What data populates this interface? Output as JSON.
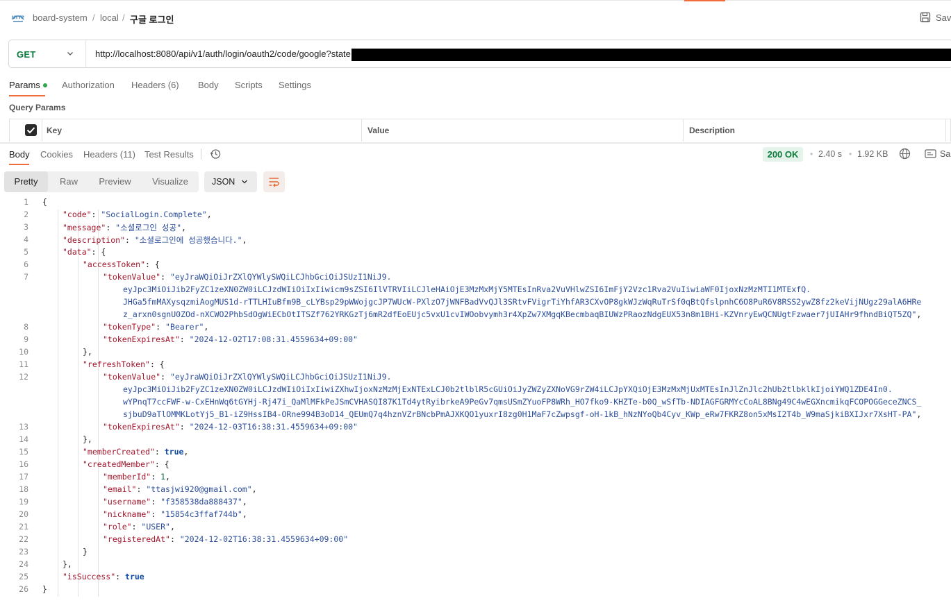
{
  "header": {
    "breadcrumb": [
      "board-system",
      "local",
      "구글 로그인"
    ],
    "save_label": "Save"
  },
  "request": {
    "method": "GET",
    "url": "http://localhost:8080/api/v1/auth/login/oauth2/code/google?state"
  },
  "request_tabs": [
    {
      "label": "Params"
    },
    {
      "label": "Authorization"
    },
    {
      "label": "Headers (6)"
    },
    {
      "label": "Body"
    },
    {
      "label": "Scripts"
    },
    {
      "label": "Settings"
    }
  ],
  "query_params": {
    "title": "Query Params",
    "columns": [
      "Key",
      "Value",
      "Description"
    ]
  },
  "response_tabs": [
    {
      "label": "Body"
    },
    {
      "label": "Cookies"
    },
    {
      "label": "Headers (11)"
    },
    {
      "label": "Test Results"
    }
  ],
  "response_meta": {
    "status": "200 OK",
    "time": "2.40 s",
    "size": "1.92 KB",
    "save_label": "Sa"
  },
  "view_modes": [
    "Pretty",
    "Raw",
    "Preview",
    "Visualize"
  ],
  "format": "JSON",
  "code_lines": [
    {
      "n": "1",
      "d": 0,
      "t": [
        [
          "p",
          "{"
        ]
      ]
    },
    {
      "n": "2",
      "d": 1,
      "t": [
        [
          "k",
          "\"code\""
        ],
        [
          "p",
          ": "
        ],
        [
          "s",
          "\"SocialLogin.Complete\""
        ],
        [
          "p",
          ","
        ]
      ]
    },
    {
      "n": "3",
      "d": 1,
      "t": [
        [
          "k",
          "\"message\""
        ],
        [
          "p",
          ": "
        ],
        [
          "s",
          "\"소셜로그인 성공\""
        ],
        [
          "p",
          ","
        ]
      ]
    },
    {
      "n": "4",
      "d": 1,
      "t": [
        [
          "k",
          "\"description\""
        ],
        [
          "p",
          ": "
        ],
        [
          "s",
          "\"소셜로그인에 성공했습니다.\""
        ],
        [
          "p",
          ","
        ]
      ]
    },
    {
      "n": "5",
      "d": 1,
      "t": [
        [
          "k",
          "\"data\""
        ],
        [
          "p",
          ": {"
        ]
      ]
    },
    {
      "n": "6",
      "d": 2,
      "t": [
        [
          "k",
          "\"accessToken\""
        ],
        [
          "p",
          ": {"
        ]
      ]
    },
    {
      "n": "7",
      "d": 3,
      "t": [
        [
          "k",
          "\"tokenValue\""
        ],
        [
          "p",
          ": "
        ],
        [
          "s",
          "\"eyJraWQiOiJrZXlQYWlySWQiLCJhbGciOiJSUzI1NiJ9."
        ]
      ]
    },
    {
      "n": "",
      "d": 4,
      "t": [
        [
          "s",
          "eyJpc3MiOiJib2FyZC1zeXN0ZW0iLCJzdWIiOiIxIiwicm9sZSI6IlVTRVIiLCJleHAiOjE3MzMxMjY5MTEsInRva2VuVHlwZSI6ImFjY2Vzc1Rva2VuIiwiaWF0IjoxNzMzMTI1MTExfQ."
        ]
      ]
    },
    {
      "n": "",
      "d": 4,
      "t": [
        [
          "s",
          "JHGa5fmMAXysqzmiAogMUS1d-rTTLHIuBfm9B_cLYBsp29pWWojgcJP7WUcW-PXlzO7jWNFBadVvQJl3SRtvFVigrTiYhfAR3CXvOP8gkWJzWqRuTrSf0qBtQfslpnhC6O8PuR6V8RSS2ywZ8fz2keVijNUgz29alA6HRe"
        ]
      ]
    },
    {
      "n": "",
      "d": 4,
      "t": [
        [
          "s",
          "z_arxn0sgnU0ZOd-nXCWO2PhbSdOgWiECbOtITSZf762YRKGzTj6mR2dfEoEUjc5vxU1cvIWOobvymh3r4XpZw7XMgqKBecmbaqBIUWzPRaozNdgEUX53n8m1BHi-KZVnryEwQCNUgtFzwaer7jUIAHr9fhndBiQT5ZQ\""
        ],
        [
          "p",
          ","
        ]
      ]
    },
    {
      "n": "8",
      "d": 3,
      "t": [
        [
          "k",
          "\"tokenType\""
        ],
        [
          "p",
          ": "
        ],
        [
          "s",
          "\"Bearer\""
        ],
        [
          "p",
          ","
        ]
      ]
    },
    {
      "n": "9",
      "d": 3,
      "t": [
        [
          "k",
          "\"tokenExpiresAt\""
        ],
        [
          "p",
          ": "
        ],
        [
          "s",
          "\"2024-12-02T17:08:31.4559634+09:00\""
        ]
      ]
    },
    {
      "n": "10",
      "d": 2,
      "t": [
        [
          "p",
          "},"
        ]
      ]
    },
    {
      "n": "11",
      "d": 2,
      "t": [
        [
          "k",
          "\"refreshToken\""
        ],
        [
          "p",
          ": {"
        ]
      ]
    },
    {
      "n": "12",
      "d": 3,
      "t": [
        [
          "k",
          "\"tokenValue\""
        ],
        [
          "p",
          ": "
        ],
        [
          "s",
          "\"eyJraWQiOiJrZXlQYWlySWQiLCJhbGciOiJSUzI1NiJ9."
        ]
      ]
    },
    {
      "n": "",
      "d": 4,
      "t": [
        [
          "s",
          "eyJpc3MiOiJib2FyZC1zeXN0ZW0iLCJzdWIiOiIxIiwiZXhwIjoxNzMzMjExNTExLCJ0b2tlblR5cGUiOiJyZWZyZXNoVG9rZW4iLCJpYXQiOjE3MzMxMjUxMTEsInJlZnJlc2hUb2tlbklkIjoiYWQ1ZDE4In0."
        ]
      ]
    },
    {
      "n": "",
      "d": 4,
      "t": [
        [
          "s",
          "wYPnqT7ccFWF-w-CxEHnWq6tGYHj-Rj47i_QaMlMFkPeJSmCVHASQI87K1Td4ytRyibrkeA9PeGv7qmsUSmZYuoFP8WRh_HO7fko9-KHZTe-b0Q_wSfTb-NDIAGFGRMYcCoAL8BNg49C4wEGXncmikqFCOPOGGeceZNCS_"
        ]
      ]
    },
    {
      "n": "",
      "d": 4,
      "t": [
        [
          "s",
          "sjbuD9aTlOMMKLotYj5_B1-iZ9HssIB4-ORne994B3oD14_QEUmQ7q4hznVZrBNcbPmAJXKQO1yuxrI8zg0H1MaF7cZwpsgf-oH-1kB_hNzNYoQb4Cyv_KWp_eRw7FKRZ8on5xMsI2T4b_W9maSjkiBXIJxr7XsHT-PA\""
        ],
        [
          "p",
          ","
        ]
      ]
    },
    {
      "n": "13",
      "d": 3,
      "t": [
        [
          "k",
          "\"tokenExpiresAt\""
        ],
        [
          "p",
          ": "
        ],
        [
          "s",
          "\"2024-12-03T16:38:31.4559634+09:00\""
        ]
      ]
    },
    {
      "n": "14",
      "d": 2,
      "t": [
        [
          "p",
          "},"
        ]
      ]
    },
    {
      "n": "15",
      "d": 2,
      "t": [
        [
          "k",
          "\"memberCreated\""
        ],
        [
          "p",
          ": "
        ],
        [
          "b",
          "true"
        ],
        [
          "p",
          ","
        ]
      ]
    },
    {
      "n": "16",
      "d": 2,
      "t": [
        [
          "k",
          "\"createdMember\""
        ],
        [
          "p",
          ": {"
        ]
      ]
    },
    {
      "n": "17",
      "d": 3,
      "t": [
        [
          "k",
          "\"memberId\""
        ],
        [
          "p",
          ": "
        ],
        [
          "n",
          "1"
        ],
        [
          "p",
          ","
        ]
      ]
    },
    {
      "n": "18",
      "d": 3,
      "t": [
        [
          "k",
          "\"email\""
        ],
        [
          "p",
          ": "
        ],
        [
          "s",
          "\"ttasjwi920@gmail.com\""
        ],
        [
          "p",
          ","
        ]
      ]
    },
    {
      "n": "19",
      "d": 3,
      "t": [
        [
          "k",
          "\"username\""
        ],
        [
          "p",
          ": "
        ],
        [
          "s",
          "\"f358538da888437\""
        ],
        [
          "p",
          ","
        ]
      ]
    },
    {
      "n": "20",
      "d": 3,
      "t": [
        [
          "k",
          "\"nickname\""
        ],
        [
          "p",
          ": "
        ],
        [
          "s",
          "\"15854c3ffaf744b\""
        ],
        [
          "p",
          ","
        ]
      ]
    },
    {
      "n": "21",
      "d": 3,
      "t": [
        [
          "k",
          "\"role\""
        ],
        [
          "p",
          ": "
        ],
        [
          "s",
          "\"USER\""
        ],
        [
          "p",
          ","
        ]
      ]
    },
    {
      "n": "22",
      "d": 3,
      "t": [
        [
          "k",
          "\"registeredAt\""
        ],
        [
          "p",
          ": "
        ],
        [
          "s",
          "\"2024-12-02T16:38:31.4559634+09:00\""
        ]
      ]
    },
    {
      "n": "23",
      "d": 2,
      "t": [
        [
          "p",
          "}"
        ]
      ]
    },
    {
      "n": "24",
      "d": 1,
      "t": [
        [
          "p",
          "},"
        ]
      ]
    },
    {
      "n": "25",
      "d": 1,
      "t": [
        [
          "k",
          "\"isSuccess\""
        ],
        [
          "p",
          ": "
        ],
        [
          "b",
          "true"
        ]
      ]
    },
    {
      "n": "26",
      "d": 0,
      "t": [
        [
          "p",
          "}"
        ]
      ]
    }
  ],
  "colors": {
    "accent": "#f26b3a",
    "method_get": "#0b7a3b",
    "status_ok_bg": "#e5f4ea",
    "json_key": "#a3152b",
    "json_string": "#2b4d9b",
    "json_boolean": "#0f4aa8"
  },
  "icons": [
    "http-icon",
    "save-icon",
    "chevron-down-icon",
    "checkbox-icon",
    "history-icon",
    "globe-icon",
    "save-response-icon",
    "wrap-lines-icon"
  ]
}
